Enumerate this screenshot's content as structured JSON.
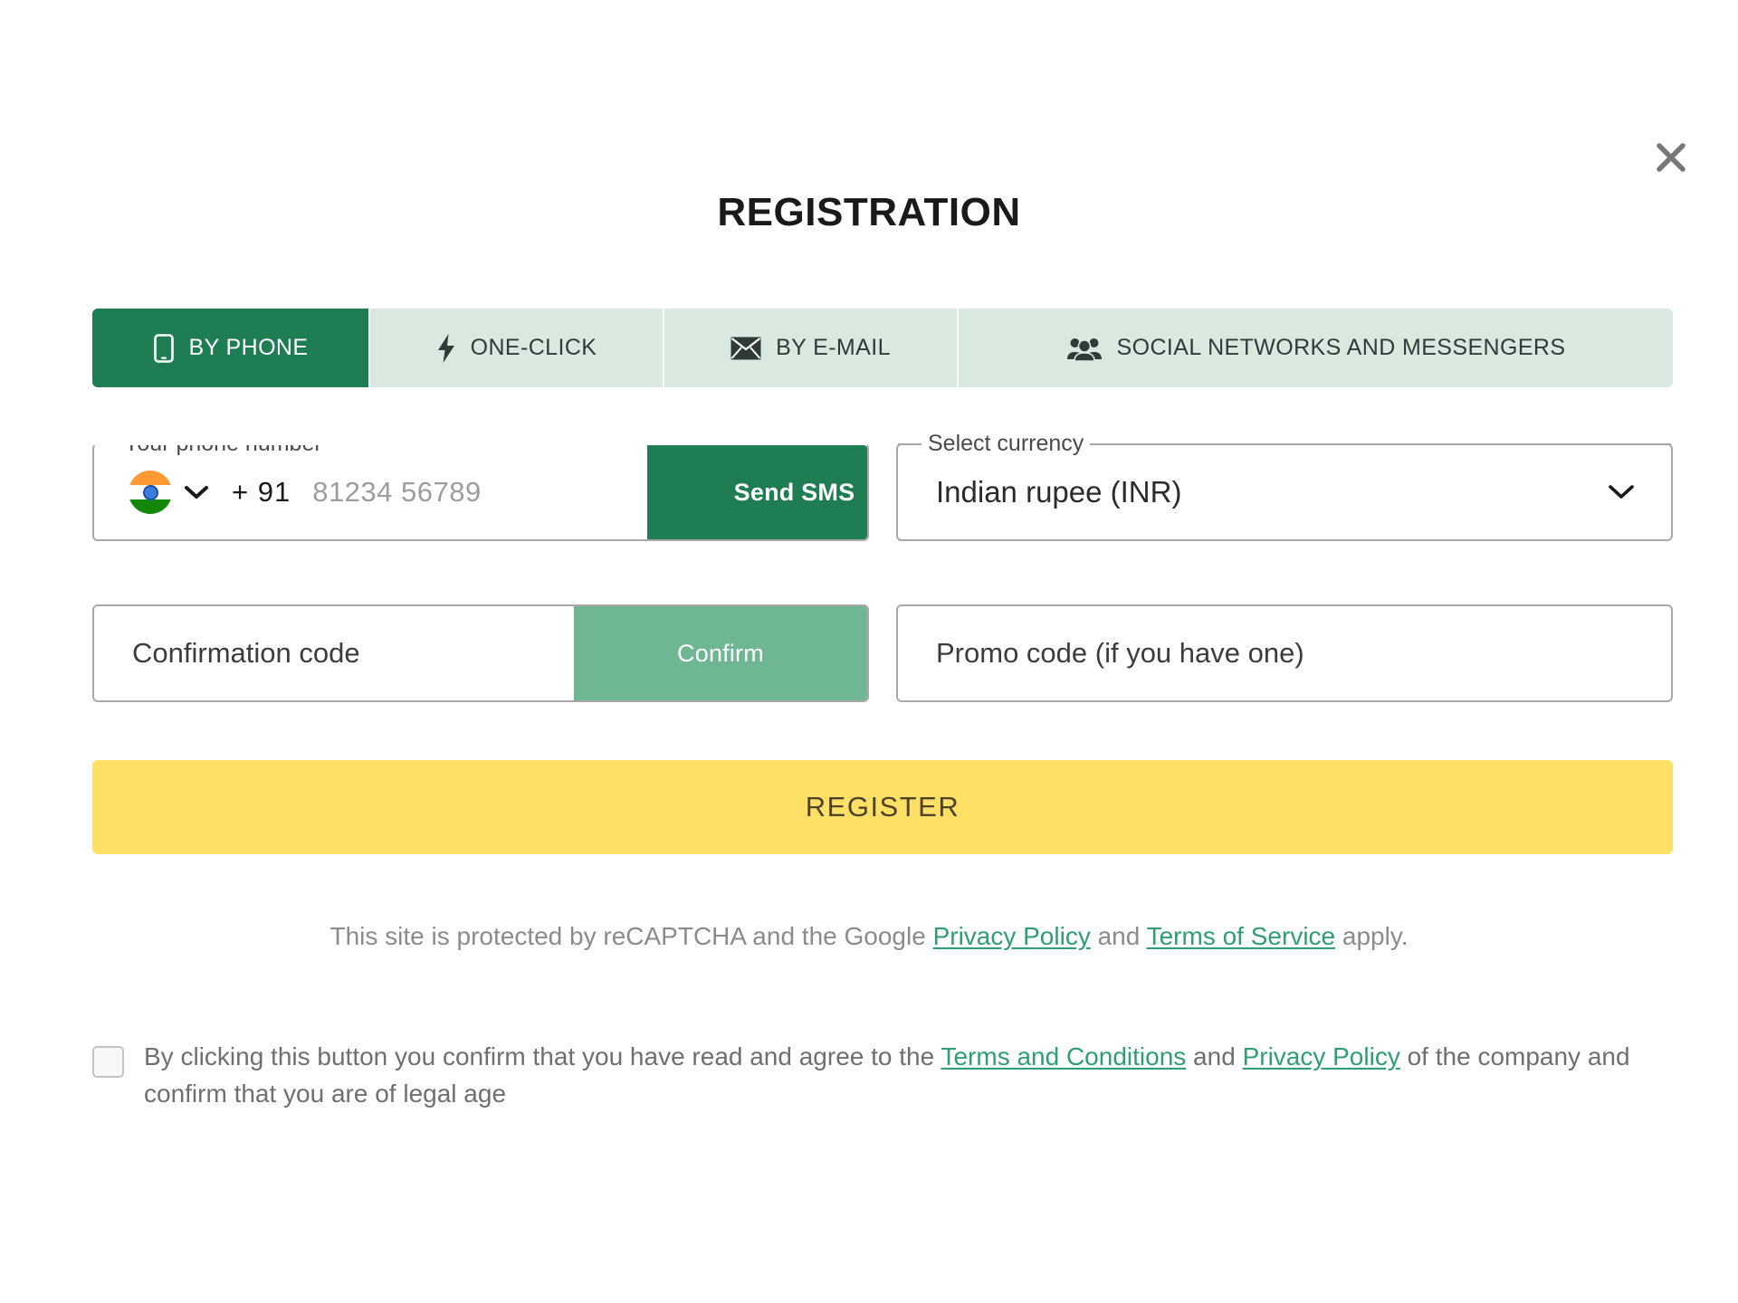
{
  "modal": {
    "title": "REGISTRATION",
    "close_icon": "close-icon"
  },
  "tabs": [
    {
      "id": "by-phone",
      "label": "BY PHONE",
      "icon": "mobile-phone-icon",
      "active": true
    },
    {
      "id": "one-click",
      "label": "ONE-CLICK",
      "icon": "lightning-bolt-icon",
      "active": false
    },
    {
      "id": "by-email",
      "label": "BY E-MAIL",
      "icon": "envelope-icon",
      "active": false
    },
    {
      "id": "social-networks",
      "label": "SOCIAL NETWORKS AND MESSENGERS",
      "icon": "people-group-icon",
      "active": false
    }
  ],
  "phone": {
    "legend": "Your phone number",
    "country_flag": "india-flag-icon",
    "dial_code": "+ 91",
    "placeholder": "81234 56789",
    "value": "",
    "send_sms_label": "Send SMS"
  },
  "currency": {
    "legend": "Select currency",
    "selected": "Indian rupee (INR)",
    "caret_icon": "chevron-down-icon"
  },
  "confirmation": {
    "placeholder": "Confirmation code",
    "value": "",
    "confirm_label": "Confirm"
  },
  "promo": {
    "placeholder": "Promo code (if you have one)",
    "value": ""
  },
  "register": {
    "label": "REGISTER"
  },
  "recaptcha": {
    "prefix": "This site is protected by reCAPTCHA and the Google ",
    "link1": "Privacy Policy",
    "middle": " and ",
    "link2": "Terms of Service",
    "suffix": " apply."
  },
  "terms": {
    "checked": false,
    "prefix": "By clicking this button you confirm that you have read and agree to the ",
    "link1": "Terms and Conditions",
    "middle": " and ",
    "link2": "Privacy Policy",
    "suffix": " of the company and confirm that you are of legal age"
  },
  "colors": {
    "brand_green": "#1e7d53",
    "tab_inactive": "#d9e9e0",
    "confirm_green": "#6fb693",
    "register_yellow": "#ffe066",
    "link_green": "#2f9e74"
  }
}
